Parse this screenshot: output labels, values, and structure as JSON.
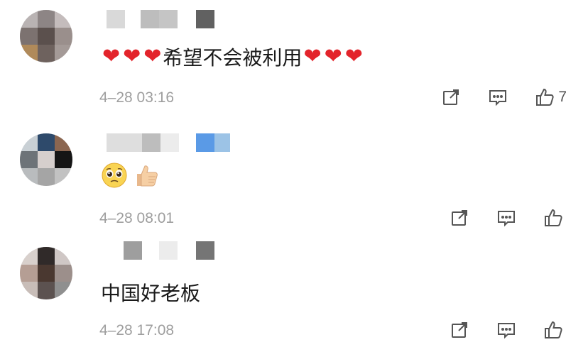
{
  "comments": [
    {
      "content_text": "希望不会被利用",
      "hearts_before": 3,
      "hearts_after": 3,
      "timestamp": "4–28 03:16",
      "like_count": "7"
    },
    {
      "content_emojis": [
        "pleading-face",
        "thumbs-up"
      ],
      "timestamp": "4–28 08:01",
      "like_count": ""
    },
    {
      "content_text": "中国好老板",
      "timestamp": "4–28 17:08",
      "like_count": ""
    }
  ],
  "icons": {
    "share": "share-icon",
    "reply": "comment-icon",
    "like": "thumbs-up-icon"
  },
  "colors": {
    "heart": "#e3242b",
    "timestamp": "#9e9e9e",
    "icon": "#555555"
  }
}
